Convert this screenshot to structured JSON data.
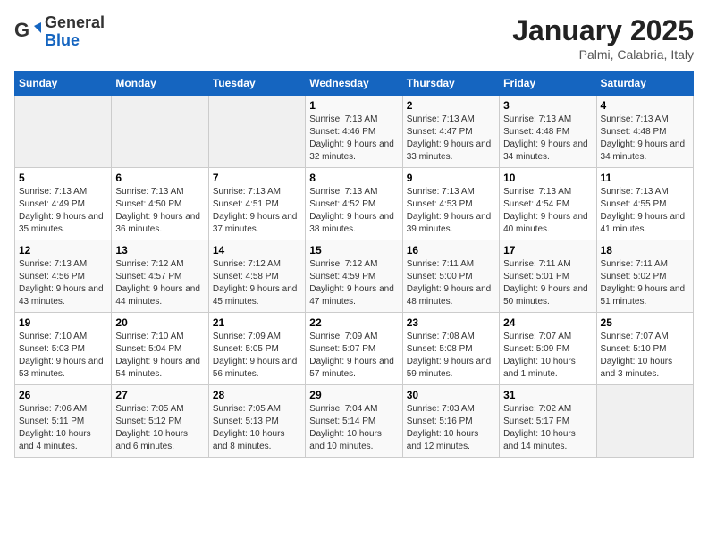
{
  "header": {
    "logo_general": "General",
    "logo_blue": "Blue",
    "month": "January 2025",
    "location": "Palmi, Calabria, Italy"
  },
  "days_of_week": [
    "Sunday",
    "Monday",
    "Tuesday",
    "Wednesday",
    "Thursday",
    "Friday",
    "Saturday"
  ],
  "weeks": [
    [
      {
        "day": "",
        "info": ""
      },
      {
        "day": "",
        "info": ""
      },
      {
        "day": "",
        "info": ""
      },
      {
        "day": "1",
        "info": "Sunrise: 7:13 AM\nSunset: 4:46 PM\nDaylight: 9 hours and 32 minutes."
      },
      {
        "day": "2",
        "info": "Sunrise: 7:13 AM\nSunset: 4:47 PM\nDaylight: 9 hours and 33 minutes."
      },
      {
        "day": "3",
        "info": "Sunrise: 7:13 AM\nSunset: 4:48 PM\nDaylight: 9 hours and 34 minutes."
      },
      {
        "day": "4",
        "info": "Sunrise: 7:13 AM\nSunset: 4:48 PM\nDaylight: 9 hours and 34 minutes."
      }
    ],
    [
      {
        "day": "5",
        "info": "Sunrise: 7:13 AM\nSunset: 4:49 PM\nDaylight: 9 hours and 35 minutes."
      },
      {
        "day": "6",
        "info": "Sunrise: 7:13 AM\nSunset: 4:50 PM\nDaylight: 9 hours and 36 minutes."
      },
      {
        "day": "7",
        "info": "Sunrise: 7:13 AM\nSunset: 4:51 PM\nDaylight: 9 hours and 37 minutes."
      },
      {
        "day": "8",
        "info": "Sunrise: 7:13 AM\nSunset: 4:52 PM\nDaylight: 9 hours and 38 minutes."
      },
      {
        "day": "9",
        "info": "Sunrise: 7:13 AM\nSunset: 4:53 PM\nDaylight: 9 hours and 39 minutes."
      },
      {
        "day": "10",
        "info": "Sunrise: 7:13 AM\nSunset: 4:54 PM\nDaylight: 9 hours and 40 minutes."
      },
      {
        "day": "11",
        "info": "Sunrise: 7:13 AM\nSunset: 4:55 PM\nDaylight: 9 hours and 41 minutes."
      }
    ],
    [
      {
        "day": "12",
        "info": "Sunrise: 7:13 AM\nSunset: 4:56 PM\nDaylight: 9 hours and 43 minutes."
      },
      {
        "day": "13",
        "info": "Sunrise: 7:12 AM\nSunset: 4:57 PM\nDaylight: 9 hours and 44 minutes."
      },
      {
        "day": "14",
        "info": "Sunrise: 7:12 AM\nSunset: 4:58 PM\nDaylight: 9 hours and 45 minutes."
      },
      {
        "day": "15",
        "info": "Sunrise: 7:12 AM\nSunset: 4:59 PM\nDaylight: 9 hours and 47 minutes."
      },
      {
        "day": "16",
        "info": "Sunrise: 7:11 AM\nSunset: 5:00 PM\nDaylight: 9 hours and 48 minutes."
      },
      {
        "day": "17",
        "info": "Sunrise: 7:11 AM\nSunset: 5:01 PM\nDaylight: 9 hours and 50 minutes."
      },
      {
        "day": "18",
        "info": "Sunrise: 7:11 AM\nSunset: 5:02 PM\nDaylight: 9 hours and 51 minutes."
      }
    ],
    [
      {
        "day": "19",
        "info": "Sunrise: 7:10 AM\nSunset: 5:03 PM\nDaylight: 9 hours and 53 minutes."
      },
      {
        "day": "20",
        "info": "Sunrise: 7:10 AM\nSunset: 5:04 PM\nDaylight: 9 hours and 54 minutes."
      },
      {
        "day": "21",
        "info": "Sunrise: 7:09 AM\nSunset: 5:05 PM\nDaylight: 9 hours and 56 minutes."
      },
      {
        "day": "22",
        "info": "Sunrise: 7:09 AM\nSunset: 5:07 PM\nDaylight: 9 hours and 57 minutes."
      },
      {
        "day": "23",
        "info": "Sunrise: 7:08 AM\nSunset: 5:08 PM\nDaylight: 9 hours and 59 minutes."
      },
      {
        "day": "24",
        "info": "Sunrise: 7:07 AM\nSunset: 5:09 PM\nDaylight: 10 hours and 1 minute."
      },
      {
        "day": "25",
        "info": "Sunrise: 7:07 AM\nSunset: 5:10 PM\nDaylight: 10 hours and 3 minutes."
      }
    ],
    [
      {
        "day": "26",
        "info": "Sunrise: 7:06 AM\nSunset: 5:11 PM\nDaylight: 10 hours and 4 minutes."
      },
      {
        "day": "27",
        "info": "Sunrise: 7:05 AM\nSunset: 5:12 PM\nDaylight: 10 hours and 6 minutes."
      },
      {
        "day": "28",
        "info": "Sunrise: 7:05 AM\nSunset: 5:13 PM\nDaylight: 10 hours and 8 minutes."
      },
      {
        "day": "29",
        "info": "Sunrise: 7:04 AM\nSunset: 5:14 PM\nDaylight: 10 hours and 10 minutes."
      },
      {
        "day": "30",
        "info": "Sunrise: 7:03 AM\nSunset: 5:16 PM\nDaylight: 10 hours and 12 minutes."
      },
      {
        "day": "31",
        "info": "Sunrise: 7:02 AM\nSunset: 5:17 PM\nDaylight: 10 hours and 14 minutes."
      },
      {
        "day": "",
        "info": ""
      }
    ]
  ]
}
